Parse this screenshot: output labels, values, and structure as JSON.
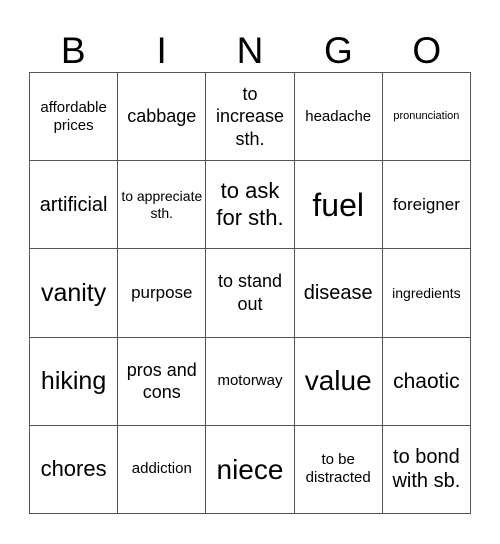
{
  "card": {
    "header": [
      "B",
      "I",
      "N",
      "G",
      "O"
    ],
    "rows": [
      [
        "affordable prices",
        "cabbage",
        "to increase sth.",
        "headache",
        "pronunciation"
      ],
      [
        "artificial",
        "to appreciate sth.",
        "to ask for sth.",
        "fuel",
        "foreigner"
      ],
      [
        "vanity",
        "purpose",
        "to stand out",
        "disease",
        "ingredients"
      ],
      [
        "hiking",
        "pros and cons",
        "motorway",
        "value",
        "chaotic"
      ],
      [
        "chores",
        "addiction",
        "niece",
        "to be distracted",
        "to bond with sb."
      ]
    ]
  }
}
